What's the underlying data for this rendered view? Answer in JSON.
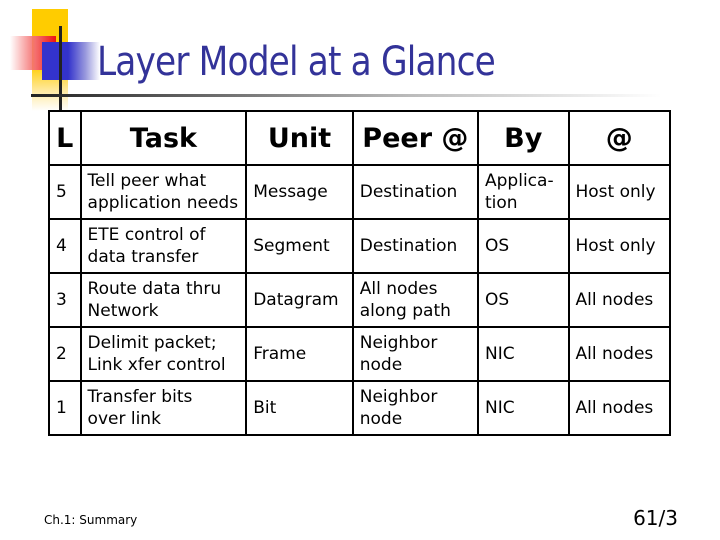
{
  "slide": {
    "title": "Layer Model at a Glance",
    "footer_left": "Ch.1: Summary",
    "page_number": "61/3",
    "colors": {
      "title": "#333399",
      "accent_yellow": "#ffcc00",
      "accent_red": "#ee1111",
      "accent_blue": "#3333cc"
    }
  },
  "table": {
    "headers": [
      "L",
      "Task",
      "Unit",
      "Peer @",
      "By",
      "@"
    ],
    "rows": [
      {
        "layer": "5",
        "task": [
          "Tell peer what",
          "application needs"
        ],
        "unit": "Message",
        "peer": [
          "Destination"
        ],
        "by": [
          "Applica-",
          "tion"
        ],
        "addr": "Host only"
      },
      {
        "layer": "4",
        "task": [
          "ETE control of",
          "data transfer"
        ],
        "unit": "Segment",
        "peer": [
          "Destination"
        ],
        "by": [
          "OS"
        ],
        "addr": "Host only"
      },
      {
        "layer": "3",
        "task": [
          "Route data thru",
          "Network"
        ],
        "unit": "Datagram",
        "peer": [
          "All nodes",
          "along path"
        ],
        "by": [
          "OS"
        ],
        "addr": "All nodes"
      },
      {
        "layer": "2",
        "task": [
          "Delimit packet;",
          "Link xfer control"
        ],
        "unit": "Frame",
        "peer": [
          "Neighbor",
          "node"
        ],
        "by": [
          "NIC"
        ],
        "addr": "All nodes"
      },
      {
        "layer": "1",
        "task": [
          "Transfer bits",
          "over link"
        ],
        "unit": "Bit",
        "peer": [
          "Neighbor",
          "node"
        ],
        "by": [
          "NIC"
        ],
        "addr": "All nodes"
      }
    ]
  }
}
